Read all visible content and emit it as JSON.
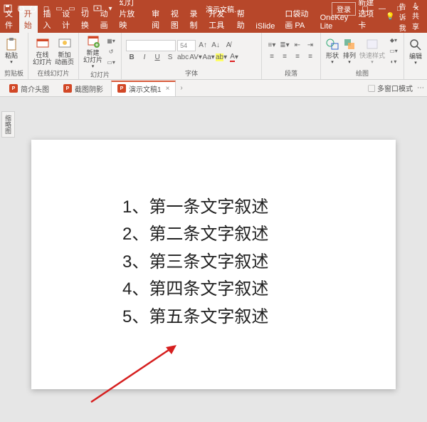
{
  "titlebar": {
    "app_title": "演示文稿…",
    "login": "登录",
    "save_icon": "save",
    "undo_icon": "undo",
    "redo_icon": "redo"
  },
  "tabs": {
    "file": "文件",
    "home": "开始",
    "insert": "插入",
    "design": "设计",
    "transitions": "切换",
    "animations": "动画",
    "slideshow": "幻灯片放映",
    "review": "审阅",
    "view": "视图",
    "record": "录制",
    "dev": "开发工具",
    "help": "帮助",
    "islide": "iSlide",
    "koudai": "口袋动画 PA",
    "onekey": "OneKey Lite",
    "newtab": "新建选项卡",
    "tell_me": "告诉我",
    "share": "共享"
  },
  "ribbon": {
    "clipboard": {
      "paste": "粘贴",
      "group": "剪贴板"
    },
    "slides": {
      "online": "在线\n幻灯片",
      "anim": "新加\n动画页",
      "new": "新建\n幻灯片",
      "group_online": "在线幻灯片",
      "group_slide": "幻灯片"
    },
    "font": {
      "name_ph": "",
      "size_ph": "54",
      "group": "字体"
    },
    "para": {
      "group": "段落"
    },
    "drawing": {
      "shapes": "形状",
      "arrange": "排列",
      "quick": "快速样式",
      "group": "绘图"
    },
    "editing": {
      "edit": "编辑",
      "group": ""
    }
  },
  "doctabs": {
    "tab1": "简介头图",
    "tab2": "截图阴影",
    "tab3": "演示文稿1",
    "multi": "多窗口模式"
  },
  "sidebar": {
    "thumb": "缩略图"
  },
  "slide_content": {
    "line1": "1、第一条文字叙述",
    "line2": "2、第二条文字叙述",
    "line3": "3、第三条文字叙述",
    "line4": "4、第四条文字叙述",
    "line5": "5、第五条文字叙述"
  }
}
